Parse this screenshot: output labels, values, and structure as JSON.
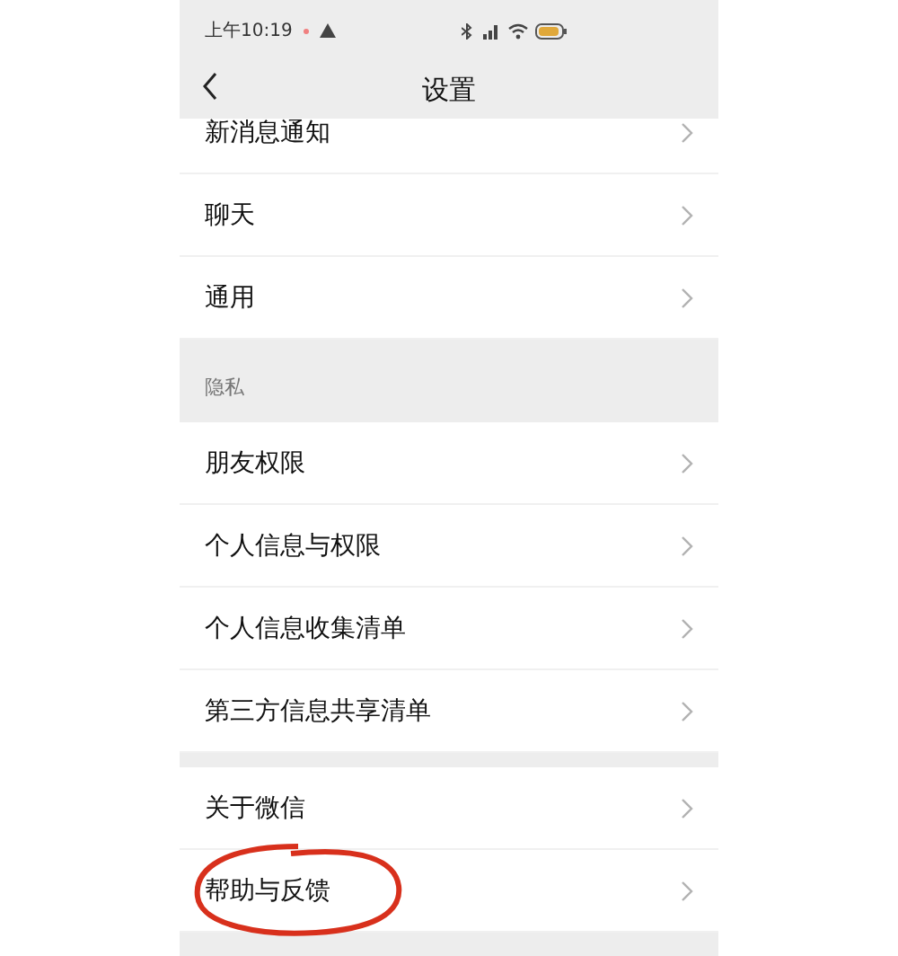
{
  "status_bar": {
    "time": "上午10:19"
  },
  "nav": {
    "title": "设置"
  },
  "sections": [
    {
      "items": [
        {
          "label": "新消息通知",
          "circled": false
        },
        {
          "label": "聊天",
          "circled": false
        },
        {
          "label": "通用",
          "circled": false
        }
      ]
    },
    {
      "header": "隐私",
      "items": [
        {
          "label": "朋友权限",
          "circled": false
        },
        {
          "label": "个人信息与权限",
          "circled": false
        },
        {
          "label": "个人信息收集清单",
          "circled": false
        },
        {
          "label": "第三方信息共享清单",
          "circled": false
        }
      ]
    },
    {
      "items": [
        {
          "label": "关于微信",
          "circled": false
        },
        {
          "label": "帮助与反馈",
          "circled": true
        }
      ]
    }
  ]
}
